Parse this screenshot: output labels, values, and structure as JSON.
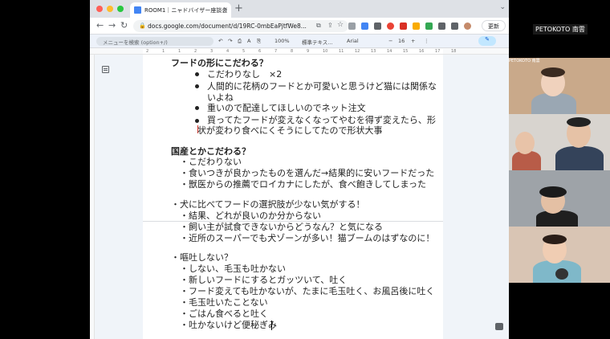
{
  "browser": {
    "tab_title": "ROOM1｜ニャドバイザー座談会",
    "tab_close": "×",
    "new_tab": "+",
    "tab_menu": "⌄",
    "url": "docs.google.com/document/d/19RC-0mbEaPjtfWe8...",
    "update_button": "更新"
  },
  "toolbar": {
    "menu_search_placeholder": "メニューを検索 (option+/)",
    "undo": "↶",
    "redo": "↷",
    "print": "⎙",
    "zoom": "100%",
    "style": "標準テキス...",
    "font": "Arial",
    "font_size": "16",
    "minus": "−",
    "plus": "+",
    "edit_mode": "✎"
  },
  "ruler_ticks": [
    "2",
    "1",
    "1",
    "2",
    "3",
    "4",
    "5",
    "6",
    "7",
    "8",
    "9",
    "10",
    "11",
    "12",
    "13",
    "14",
    "15",
    "16",
    "17",
    "18"
  ],
  "document": {
    "sec1_heading": "フードの形にこだわる？",
    "sec1_items": [
      "こだわりなし　×2",
      "人間的に花柄のフードとか可愛いと思うけど猫には関係な",
      "いよね",
      "重いので配達してほしいのでネット注文",
      "買ってたフードが変えなくなってやむを得ず変えたら、形",
      "状が変わり食べにくそうにしてたので形状大事"
    ],
    "sec2_heading": "国産とかこだわる？",
    "sec2_items": [
      "・こだわりない",
      "・食いつきが良かったものを選んだ→結果的に安いフードだった",
      "・獣医からの推薦でロイカナにしたが、食べ飽きしてしまった"
    ],
    "sec3_heading": "・犬に比べてフードの選択肢が少ない気がする！",
    "sec3_items": [
      "・結果、どれが良いのか分からない",
      "・飼い主が試食できないからどうなん？と気になる",
      "・近所のスーパーでも犬ゾーンが多い！猫ブームのはずなのに！"
    ],
    "sec4_heading": "・嘔吐しない？",
    "sec4_items": [
      "・しない、毛玉も吐かない",
      "・新しいフードにするとガッツいて、吐く",
      "・フード変えても吐かないが、たまに毛玉吐く、お風呂後に吐く",
      "・毛玉吐いたことない",
      "・ごはん食べると吐く",
      "・吐かないけど便秘ぎみ"
    ]
  },
  "zoom": {
    "host_label": "PETOKOTO 南雲",
    "tile_label": "PETOKOTO 南雲"
  },
  "colors": {
    "tabbar": "#dee1e6",
    "doc_bg": "#f0f4f9",
    "toolbar": "#edf2fa",
    "accent": "#0b57d0"
  }
}
